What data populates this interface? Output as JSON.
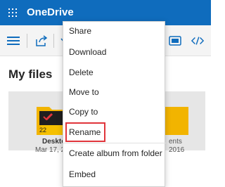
{
  "header": {
    "app_name": "OneDrive",
    "bg_color": "#0f6cbd",
    "icons": [
      "waffle-icon"
    ]
  },
  "command_bar": {
    "icons": [
      "hamburger-icon",
      "share-icon",
      "download-icon",
      "view-icon",
      "embed-icon"
    ]
  },
  "main": {
    "title": "My files",
    "tiles": [
      {
        "name": "Deskto",
        "date": "Mar 17, 2",
        "badge": "22"
      },
      {
        "name": "ents",
        "date": "2016"
      }
    ]
  },
  "context_menu": {
    "items": [
      "Share",
      "Download",
      "Delete",
      "Move to",
      "Copy to",
      "Rename",
      "Create album from folder",
      "Embed"
    ],
    "highlighted": "Rename",
    "highlight_color": "#e0353b"
  }
}
